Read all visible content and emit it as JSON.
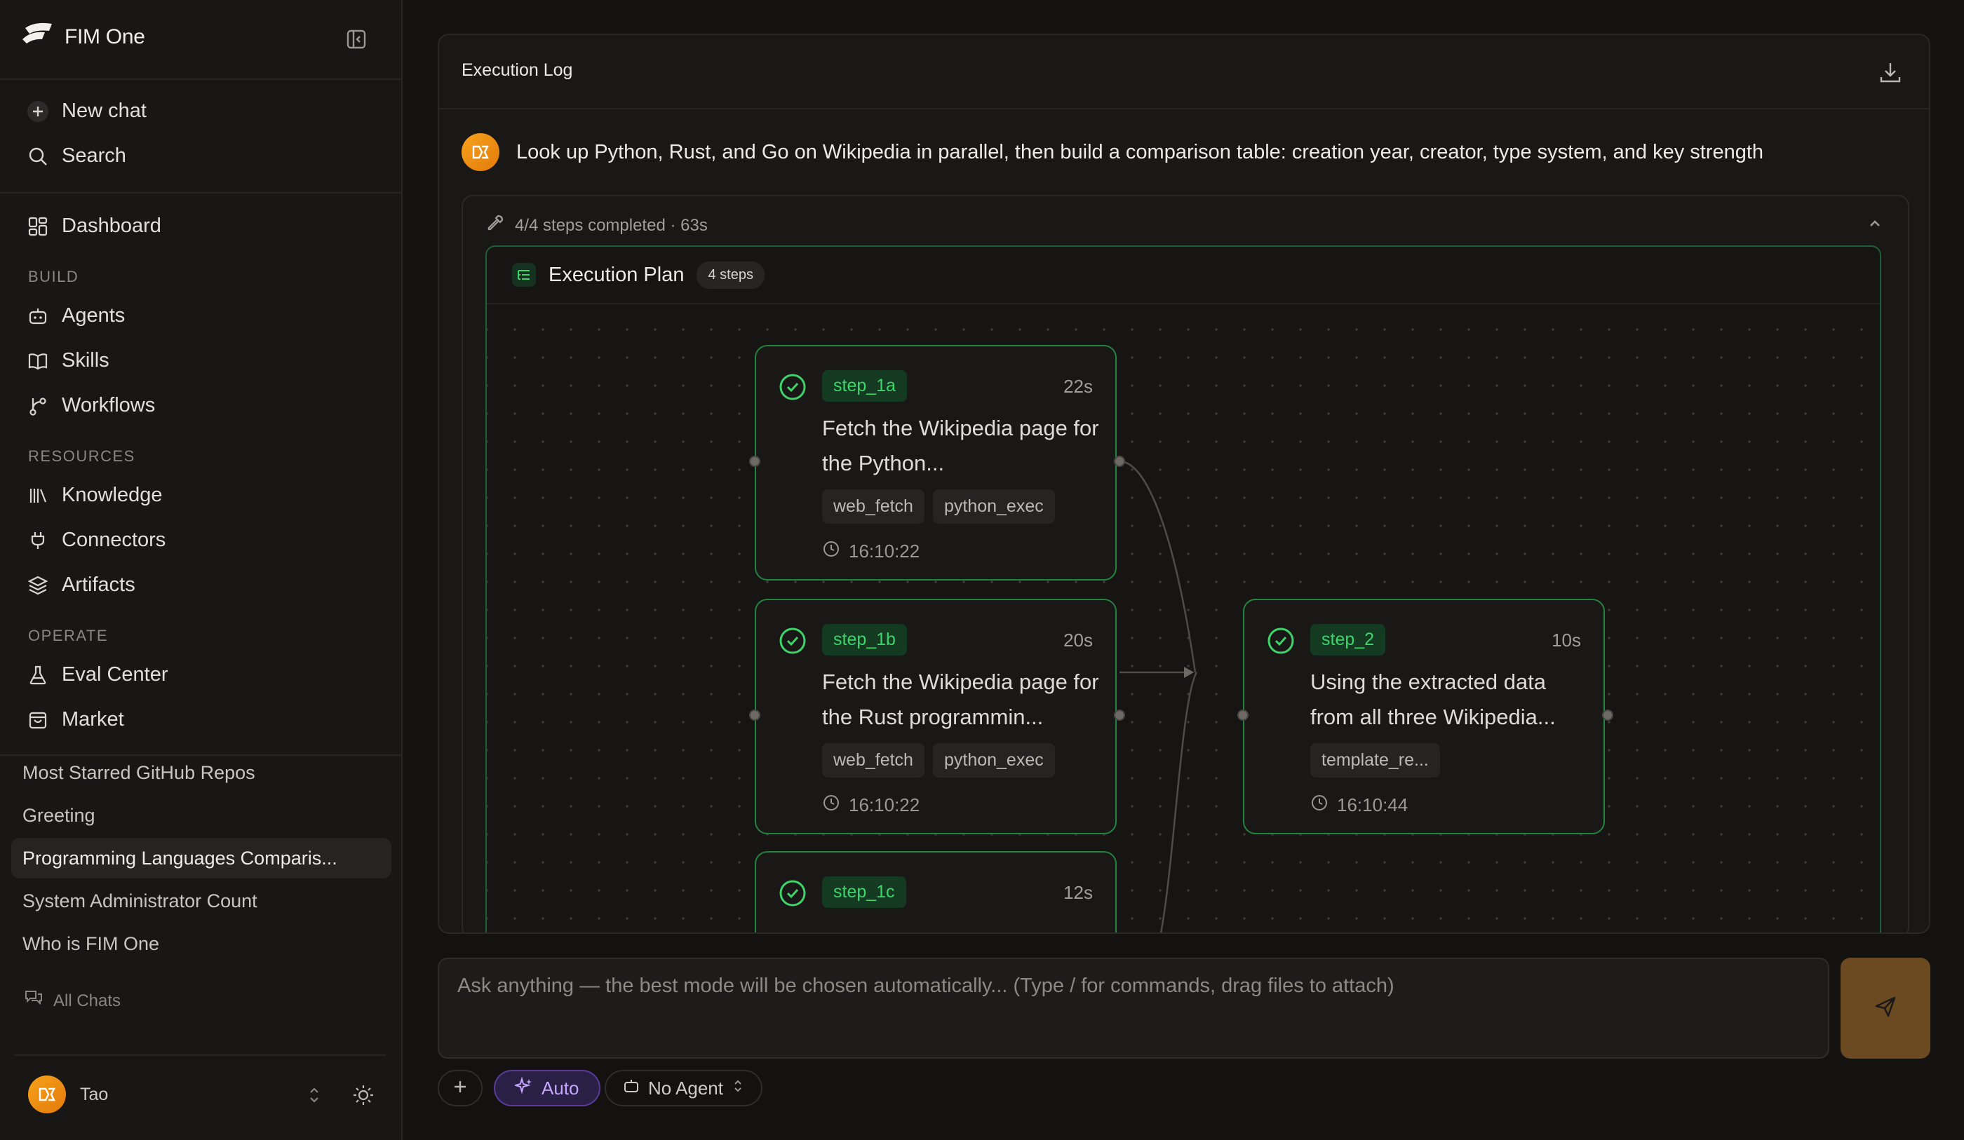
{
  "brand": {
    "name": "FIM One"
  },
  "sidebar": {
    "new_chat": "New chat",
    "search": "Search",
    "dashboard": "Dashboard",
    "sections": {
      "build": "BUILD",
      "resources": "RESOURCES",
      "operate": "OPERATE"
    },
    "build_items": [
      "Agents",
      "Skills",
      "Workflows"
    ],
    "resource_items": [
      "Knowledge",
      "Connectors",
      "Artifacts"
    ],
    "operate_items": [
      "Eval Center",
      "Market"
    ],
    "history": [
      "Most Starred GitHub Repos",
      "Greeting",
      "Programming Languages Comparis...",
      "System Administrator Count",
      "Who is FIM One"
    ],
    "all_chats": "All Chats",
    "user": {
      "name": "Tao"
    }
  },
  "panel": {
    "title": "Execution Log",
    "prompt": "Look up Python, Rust, and Go on Wikipedia in parallel, then build a comparison table: creation year, creator, type system, and key strength",
    "steps_summary": "4/4 steps completed · 63s",
    "plan": {
      "title": "Execution Plan",
      "badge": "4 steps",
      "nodes": [
        {
          "id": "step_1a",
          "duration": "22s",
          "desc": "Fetch the Wikipedia page for the Python...",
          "tags": [
            "web_fetch",
            "python_exec"
          ],
          "time": "16:10:22"
        },
        {
          "id": "step_1b",
          "duration": "20s",
          "desc": "Fetch the Wikipedia page for the Rust programmin...",
          "tags": [
            "web_fetch",
            "python_exec"
          ],
          "time": "16:10:22"
        },
        {
          "id": "step_1c",
          "duration": "12s"
        },
        {
          "id": "step_2",
          "duration": "10s",
          "desc": "Using the extracted data from all three Wikipedia...",
          "tags": [
            "template_re..."
          ],
          "time": "16:10:44"
        }
      ]
    }
  },
  "composer": {
    "placeholder": "Ask anything — the best mode will be chosen automatically... (Type / for commands, drag files to attach)",
    "mode": "Auto",
    "agent": "No Agent"
  },
  "colors": {
    "accent_green": "#3fd46a",
    "node_border": "#23833f",
    "send_bg": "#6b4a22",
    "auto_purple": "#c4a6ff"
  }
}
